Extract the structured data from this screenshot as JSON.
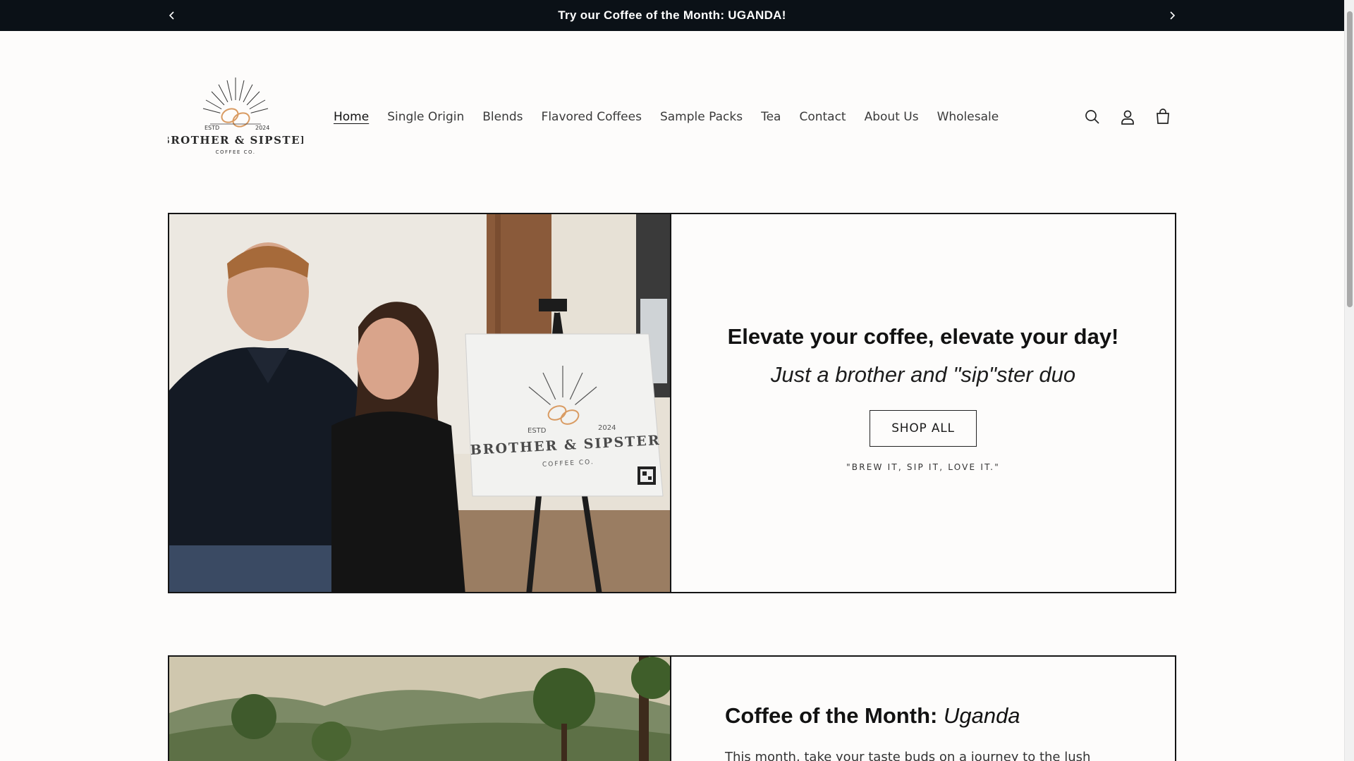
{
  "announcement": {
    "text": "Try our Coffee of the Month: UGANDA!",
    "prev_icon": "chevron-left-icon",
    "next_icon": "chevron-right-icon"
  },
  "logo": {
    "estd": "ESTD",
    "year": "2024",
    "name": "BROTHER & SIPSTER",
    "sub": "COFFEE CO."
  },
  "nav": {
    "items": [
      {
        "label": "Home",
        "active": true
      },
      {
        "label": "Single Origin"
      },
      {
        "label": "Blends"
      },
      {
        "label": "Flavored Coffees"
      },
      {
        "label": "Sample Packs"
      },
      {
        "label": "Tea"
      },
      {
        "label": "Contact"
      },
      {
        "label": "About Us"
      },
      {
        "label": "Wholesale"
      }
    ]
  },
  "header_icons": [
    "search-icon",
    "account-icon",
    "cart-icon"
  ],
  "hero": {
    "heading": "Elevate your coffee, elevate your day!",
    "subheading": "Just a brother and \"sip\"ster duo",
    "button": "SHOP ALL",
    "tagline": "\"BREW IT, SIP IT, LOVE IT.\"",
    "sign": {
      "estd": "ESTD",
      "year": "2024",
      "name": "BROTHER & SIPSTER",
      "sub": "COFFEE CO."
    }
  },
  "coffee_of_month": {
    "heading": "Coffee of the Month:",
    "heading_italic": "Uganda",
    "body": "This month, take your taste buds on a journey to the lush"
  },
  "colors": {
    "announcement_bg": "#0b1117",
    "page_bg": "#fdfcfb",
    "logo_accent": "#d99b62"
  }
}
